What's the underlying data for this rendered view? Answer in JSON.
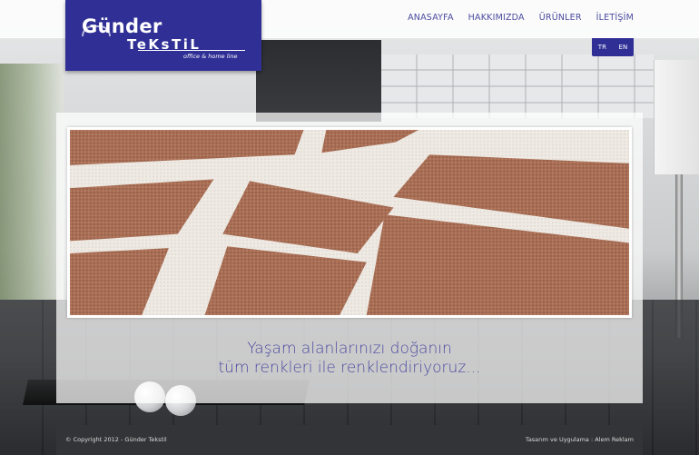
{
  "logo": {
    "main": "Günder",
    "sub": "TeKsTiL",
    "tagline": "office & home line"
  },
  "nav": {
    "items": [
      {
        "label": "ANASAYFA"
      },
      {
        "label": "HAKKIMIZDA"
      },
      {
        "label": "ÜRÜNLER"
      },
      {
        "label": "İLETİŞİM"
      }
    ]
  },
  "language": {
    "tr": "TR",
    "en": "EN"
  },
  "slogan": {
    "line1": "Yaşam alanlarınızı doğanın",
    "line2": "tüm renkleri ile renklendiriyoruz..."
  },
  "footer": {
    "copyright": "© Copyright 2012 - Günder Tekstil",
    "credit": "Tasarım ve Uygulama : Alem Reklam"
  },
  "colors": {
    "brand": "#2f2f96",
    "nav_text": "#4a4aa0",
    "footer_bg": "#333437",
    "fabric_brown": "#a86e55",
    "fabric_weave": "#efeae3"
  }
}
